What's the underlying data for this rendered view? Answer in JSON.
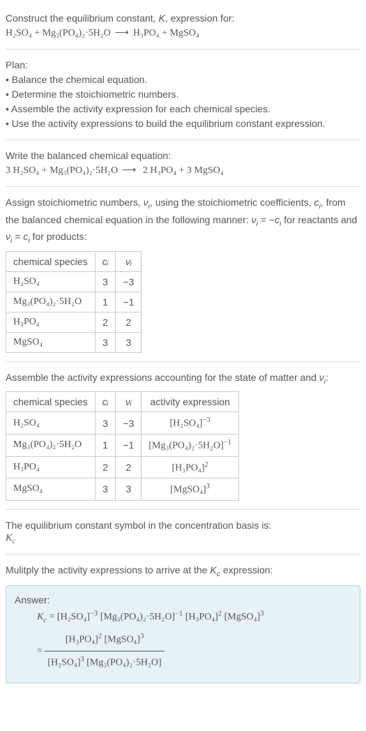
{
  "intro": {
    "line1_pre": "Construct the equilibrium constant, ",
    "line1_K": "K",
    "line1_post": ", expression for:",
    "eq_lhs1": "H₂SO₄",
    "eq_plus": " + ",
    "eq_lhs2": "Mg₃(PO₄)₂·5H₂O",
    "eq_arrow": "⟶",
    "eq_rhs1": "H₃PO₄",
    "eq_rhs2": "MgSO₄"
  },
  "plan": {
    "header": "Plan:",
    "b1": "• Balance the chemical equation.",
    "b2": "• Determine the stoichiometric numbers.",
    "b3": "• Assemble the activity expression for each chemical species.",
    "b4": "• Use the activity expressions to build the equilibrium constant expression."
  },
  "balanced": {
    "header": "Write the balanced chemical equation:",
    "lhs1_coef": "3 ",
    "lhs1": "H₂SO₄",
    "plus": " + ",
    "lhs2": "Mg₃(PO₄)₂·5H₂O",
    "arrow": "⟶",
    "rhs1_coef": " 2 ",
    "rhs1": "H₃PO₄",
    "rhs2_coef": " + 3 ",
    "rhs2": "MgSO₄"
  },
  "stoich": {
    "text1": "Assign stoichiometric numbers, ",
    "nu": "ν",
    "sub_i": "i",
    "text2": ", using the stoichiometric coefficients, ",
    "c": "c",
    "text3": ", from the balanced chemical equation in the following manner: ",
    "eq1": "ν",
    "eq2": " = −",
    "eq3": "c",
    "text4": " for reactants and ",
    "eq4": "ν",
    "eq5": " = ",
    "eq6": "c",
    "text5": " for products:"
  },
  "table1": {
    "h1": "chemical species",
    "h2": "cᵢ",
    "h3": "νᵢ",
    "rows": [
      {
        "species": "H₂SO₄",
        "c": "3",
        "nu": "−3"
      },
      {
        "species": "Mg₃(PO₄)₂·5H₂O",
        "c": "1",
        "nu": "−1"
      },
      {
        "species": "H₃PO₄",
        "c": "2",
        "nu": "2"
      },
      {
        "species": "MgSO₄",
        "c": "3",
        "nu": "3"
      }
    ]
  },
  "activity": {
    "text1": "Assemble the activity expressions accounting for the state of matter and ",
    "nu": "ν",
    "sub_i": "i",
    "text2": ":"
  },
  "table2": {
    "h1": "chemical species",
    "h2": "cᵢ",
    "h3": "νᵢ",
    "h4": "activity expression",
    "rows": [
      {
        "species": "H₂SO₄",
        "c": "3",
        "nu": "−3",
        "base": "[H₂SO₄]",
        "exp": "−3"
      },
      {
        "species": "Mg₃(PO₄)₂·5H₂O",
        "c": "1",
        "nu": "−1",
        "base": "[Mg₃(PO₄)₂·5H₂O]",
        "exp": "−1"
      },
      {
        "species": "H₃PO₄",
        "c": "2",
        "nu": "2",
        "base": "[H₃PO₄]",
        "exp": "2"
      },
      {
        "species": "MgSO₄",
        "c": "3",
        "nu": "3",
        "base": "[MgSO₄]",
        "exp": "3"
      }
    ]
  },
  "kc_symbol": {
    "text": "The equilibrium constant symbol in the concentration basis is:",
    "K": "K",
    "sub_c": "c"
  },
  "multiply": {
    "text1": "Mulitply the activity expressions to arrive at the ",
    "K": "K",
    "sub_c": "c",
    "text2": " expression:"
  },
  "answer": {
    "label": "Answer:",
    "K": "K",
    "sub_c": "c",
    "eq": " = ",
    "t1_base": "[H₂SO₄]",
    "t1_exp": "−3",
    "t2_base": "[Mg₃(PO₄)₂·5H₂O]",
    "t2_exp": "−1",
    "t3_base": "[H₃PO₄]",
    "t3_exp": "2",
    "t4_base": "[MgSO₄]",
    "t4_exp": "3",
    "eq2": "= ",
    "num1_base": "[H₃PO₄]",
    "num1_exp": "2",
    "num2_base": "[MgSO₄]",
    "num2_exp": "3",
    "den1_base": "[H₂SO₄]",
    "den1_exp": "3",
    "den2_base": "[Mg₃(PO₄)₂·5H₂O]"
  }
}
